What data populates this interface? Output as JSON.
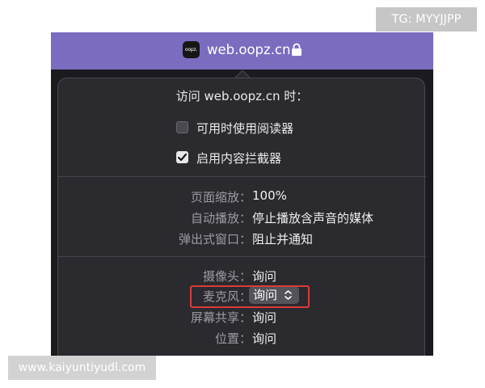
{
  "watermarks": {
    "top_right": "TG: MYYJJPP",
    "bottom_left": "www.kaiyuntiyudl.com"
  },
  "address_bar": {
    "favicon_text": "oopz.",
    "site_url": "web.oopz.cn",
    "lock_icon": "lock-icon",
    "accent_color": "#7b6cc0"
  },
  "popover": {
    "title": "访问 web.oopz.cn 时：",
    "options": [
      {
        "label": "可用时使用阅读器",
        "checked": false
      },
      {
        "label": "启用内容拦截器",
        "checked": true
      }
    ],
    "page_settings": [
      {
        "label": "页面缩放：",
        "value": "100%"
      },
      {
        "label": "自动播放：",
        "value": "停止播放含声音的媒体"
      },
      {
        "label": "弹出式窗口：",
        "value": "阻止并通知"
      }
    ],
    "permissions": [
      {
        "label": "摄像头：",
        "value": "询问"
      },
      {
        "label": "麦克风：",
        "value": "询问"
      },
      {
        "label": "屏幕共享：",
        "value": "询问"
      },
      {
        "label": "位置：",
        "value": "询问"
      }
    ],
    "highlight_color": "#d93b3b"
  }
}
